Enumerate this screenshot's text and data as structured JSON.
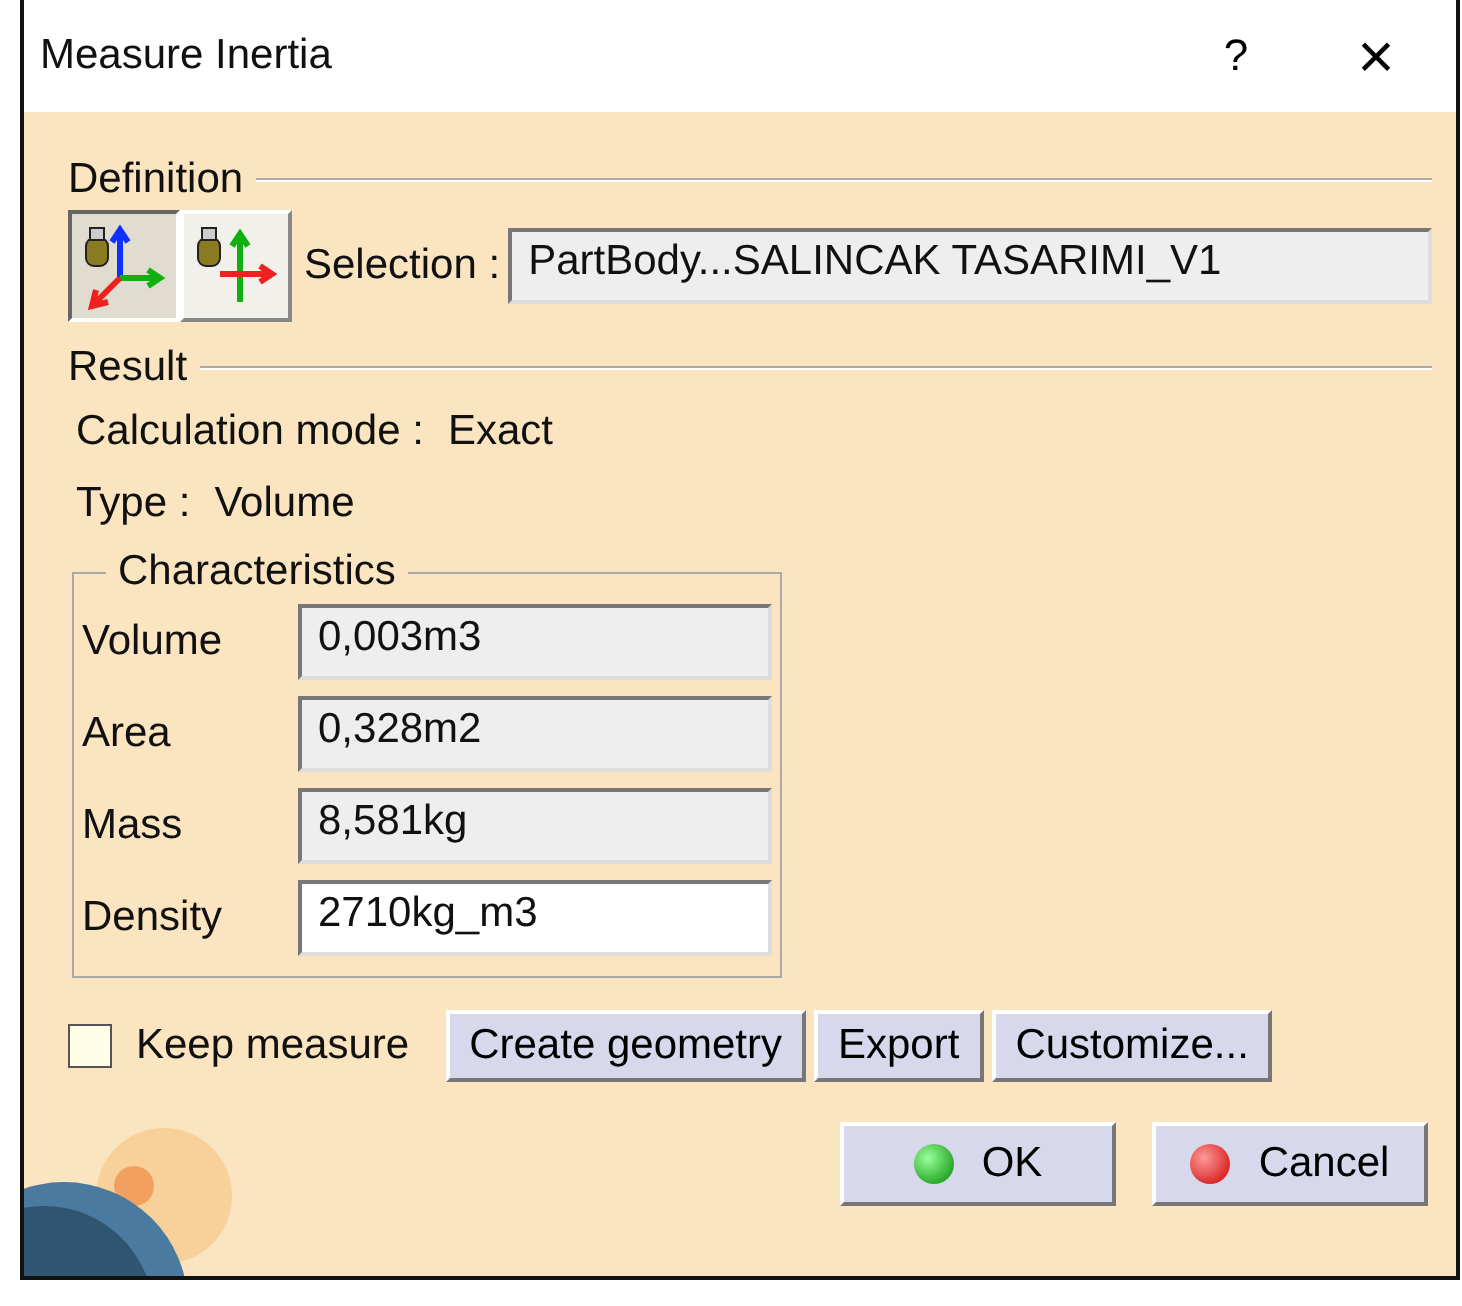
{
  "window": {
    "title": "Measure Inertia",
    "help": "?",
    "close": "×"
  },
  "definition": {
    "title": "Definition",
    "modes": [
      {
        "selected": true
      },
      {
        "selected": false
      }
    ],
    "selection_label": "Selection :",
    "selection_value": "PartBody...SALINCAK TASARIMI_V1"
  },
  "result": {
    "title": "Result",
    "lines": [
      {
        "label": "Calculation mode :",
        "value": "Exact"
      },
      {
        "label": "Type :",
        "value": "Volume"
      }
    ]
  },
  "characteristics": {
    "title": "Characteristics",
    "rows": [
      {
        "label": "Volume",
        "value": "0,003m3",
        "editable": false
      },
      {
        "label": "Area",
        "value": "0,328m2",
        "editable": false
      },
      {
        "label": "Mass",
        "value": "8,581kg",
        "editable": false
      },
      {
        "label": "Density",
        "value": "2710kg_m3",
        "editable": true
      }
    ]
  },
  "keep_measure": {
    "label": "Keep measure",
    "checked": false
  },
  "actions": [
    "Create geometry",
    "Export",
    "Customize..."
  ],
  "buttons": [
    {
      "kind": "ok",
      "label": "OK"
    },
    {
      "kind": "cancel",
      "label": "Cancel"
    }
  ]
}
